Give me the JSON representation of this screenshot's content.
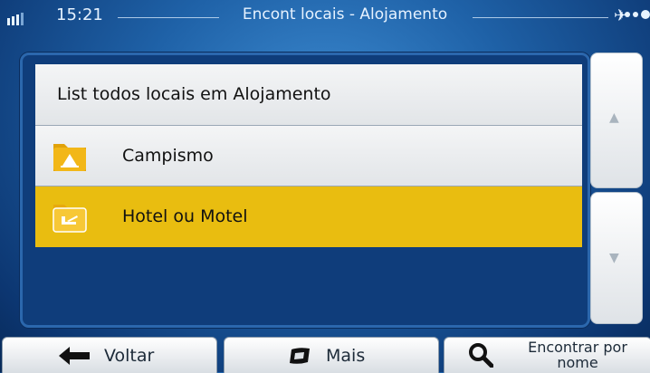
{
  "status_bar": {
    "time": "15:21",
    "title": "Encont locais - Alojamento",
    "gps_icon": "satellite-icon"
  },
  "list": {
    "header": "List todos locais em Alojamento",
    "items": [
      {
        "label": "Campismo",
        "icon": "tent-folder-icon",
        "selected": false
      },
      {
        "label": "Hotel ou Motel",
        "icon": "bed-folder-icon",
        "selected": true
      }
    ]
  },
  "scrollbar": {
    "up_symbol": "▲",
    "down_symbol": "▼"
  },
  "toolbar": {
    "back_label": "Voltar",
    "more_label": "Mais",
    "find_label_line1": "Encontrar por",
    "find_label_line2": "nome"
  },
  "colors": {
    "selection": "#e9bd10",
    "background": "#1f62a8",
    "list_bg": "#0f3d7b"
  }
}
